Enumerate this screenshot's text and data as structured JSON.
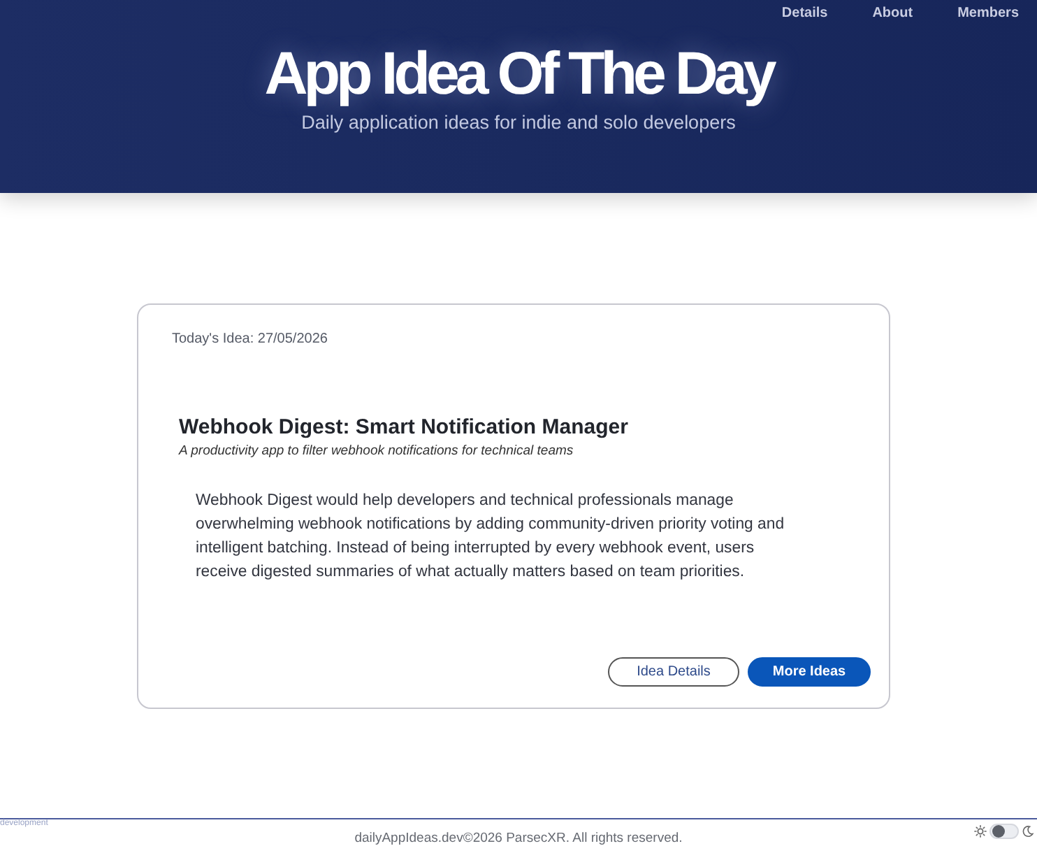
{
  "header": {
    "nav": [
      "Details",
      "About",
      "Members"
    ],
    "title": "App Idea Of The Day",
    "tagline": "Daily application ideas for indie and solo developers"
  },
  "idea_card": {
    "date_label": "Today's Idea: 27/05/2026",
    "title": "Webhook Digest: Smart Notification Manager",
    "subtitle": "A productivity app to filter webhook notifications for technical teams",
    "description": "Webhook Digest would help developers and technical professionals manage overwhelming webhook notifications by adding community-driven priority voting and intelligent batching. Instead of being interrupted by every webhook event, users receive digested summaries of what actually matters based on team priorities.",
    "buttons": [
      {
        "label": "Idea Details",
        "kind": "outline"
      },
      {
        "label": "More Ideas",
        "kind": "primary"
      }
    ]
  },
  "footer": {
    "environment": "development",
    "copyright": "dailyAppIdeas.dev©2026 ParsecXR. All rights reserved.",
    "theme_toggle": {
      "on": false
    }
  }
}
